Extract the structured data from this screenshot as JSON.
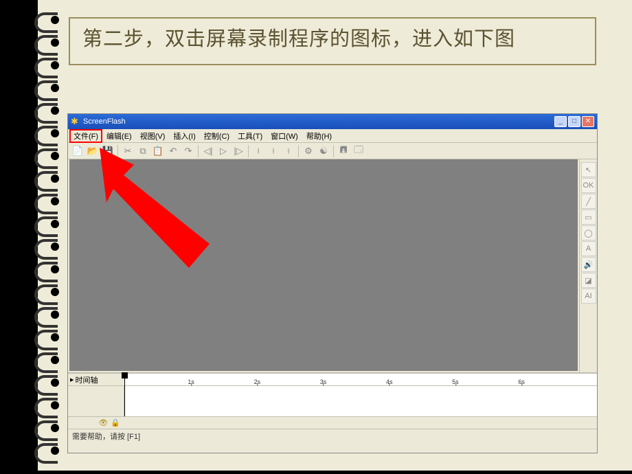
{
  "instruction": "第二步，双击屏幕录制程序的图标，进入如下图",
  "window": {
    "title": "ScreenFlash"
  },
  "menu": {
    "file": "文件(F)",
    "edit": "编辑(E)",
    "view": "视图(V)",
    "insert": "插入(I)",
    "control": "控制(C)",
    "tools": "工具(T)",
    "window": "窗口(W)",
    "help": "帮助(H)"
  },
  "side_tools": {
    "ok": "OK",
    "text": "A",
    "ai": "AI"
  },
  "timeline": {
    "label": "时间轴",
    "ticks": [
      "1s",
      "2s",
      "3s",
      "4s",
      "5s",
      "6s"
    ]
  },
  "status": "需要帮助，请按 [F1]"
}
